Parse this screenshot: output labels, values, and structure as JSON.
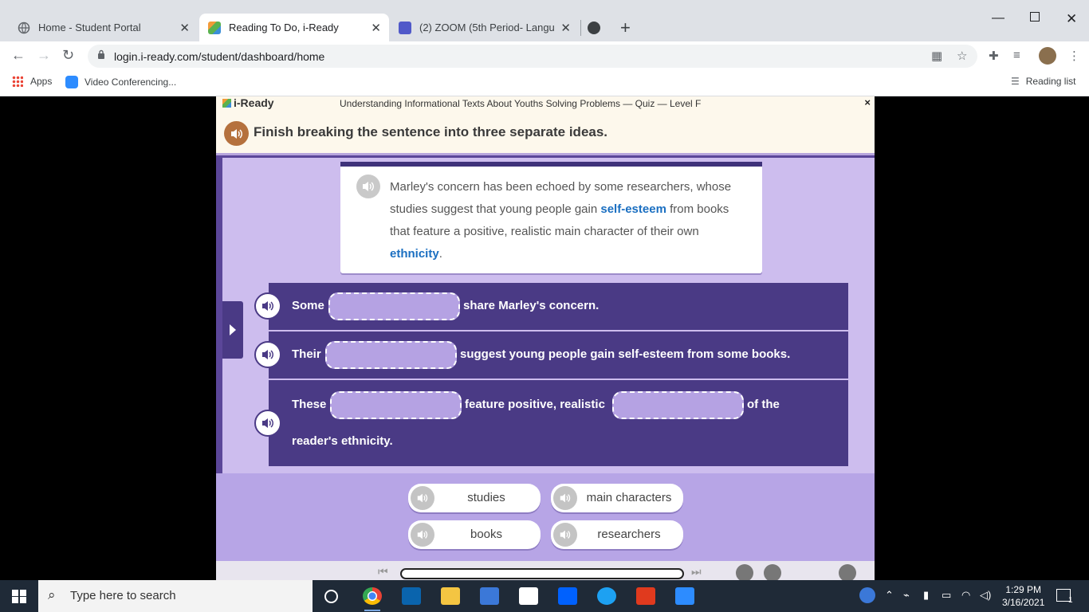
{
  "browser": {
    "tabs": [
      {
        "title": "Home - Student Portal",
        "active": false
      },
      {
        "title": "Reading To Do, i-Ready",
        "active": true
      },
      {
        "title": "(2) ZOOM (5th Period- Language",
        "active": false
      }
    ],
    "url": "login.i-ready.com/student/dashboard/home",
    "bookmarks": [
      {
        "label": "Apps"
      },
      {
        "label": "Video Conferencing..."
      }
    ],
    "reading_list": "Reading list"
  },
  "iready": {
    "logo": "i-Ready",
    "lesson_title": "Understanding Informational Texts About Youths Solving Problems — Quiz — Level F",
    "close": "×",
    "instruction": "Finish breaking the sentence into three separate ideas.",
    "passage": {
      "part1": "Marley's concern has been echoed by some researchers, whose studies suggest that young people gain ",
      "kw1": "self-esteem",
      "part2": " from books that feature a positive, realistic main character of their own ",
      "kw2": "ethnicity",
      "part3": "."
    },
    "rows": [
      {
        "before": "Some",
        "after": "share Marley's concern."
      },
      {
        "before": "Their",
        "after": "suggest young people gain self-esteem from some books."
      },
      {
        "before": "These",
        "middle": "feature positive, realistic",
        "after": "of the",
        "line2": "reader's ethnicity."
      }
    ],
    "word_bank": [
      "studies",
      "main characters",
      "books",
      "researchers"
    ]
  },
  "taskbar": {
    "search_placeholder": "Type here to search",
    "time": "1:29 PM",
    "date": "3/16/2021",
    "notifications": "1"
  },
  "colors": {
    "app_purple": "#5b4699",
    "row_purple": "#4a3a85",
    "keyword_blue": "#1b6fc1",
    "instruction_bg": "#fdf8ec"
  }
}
